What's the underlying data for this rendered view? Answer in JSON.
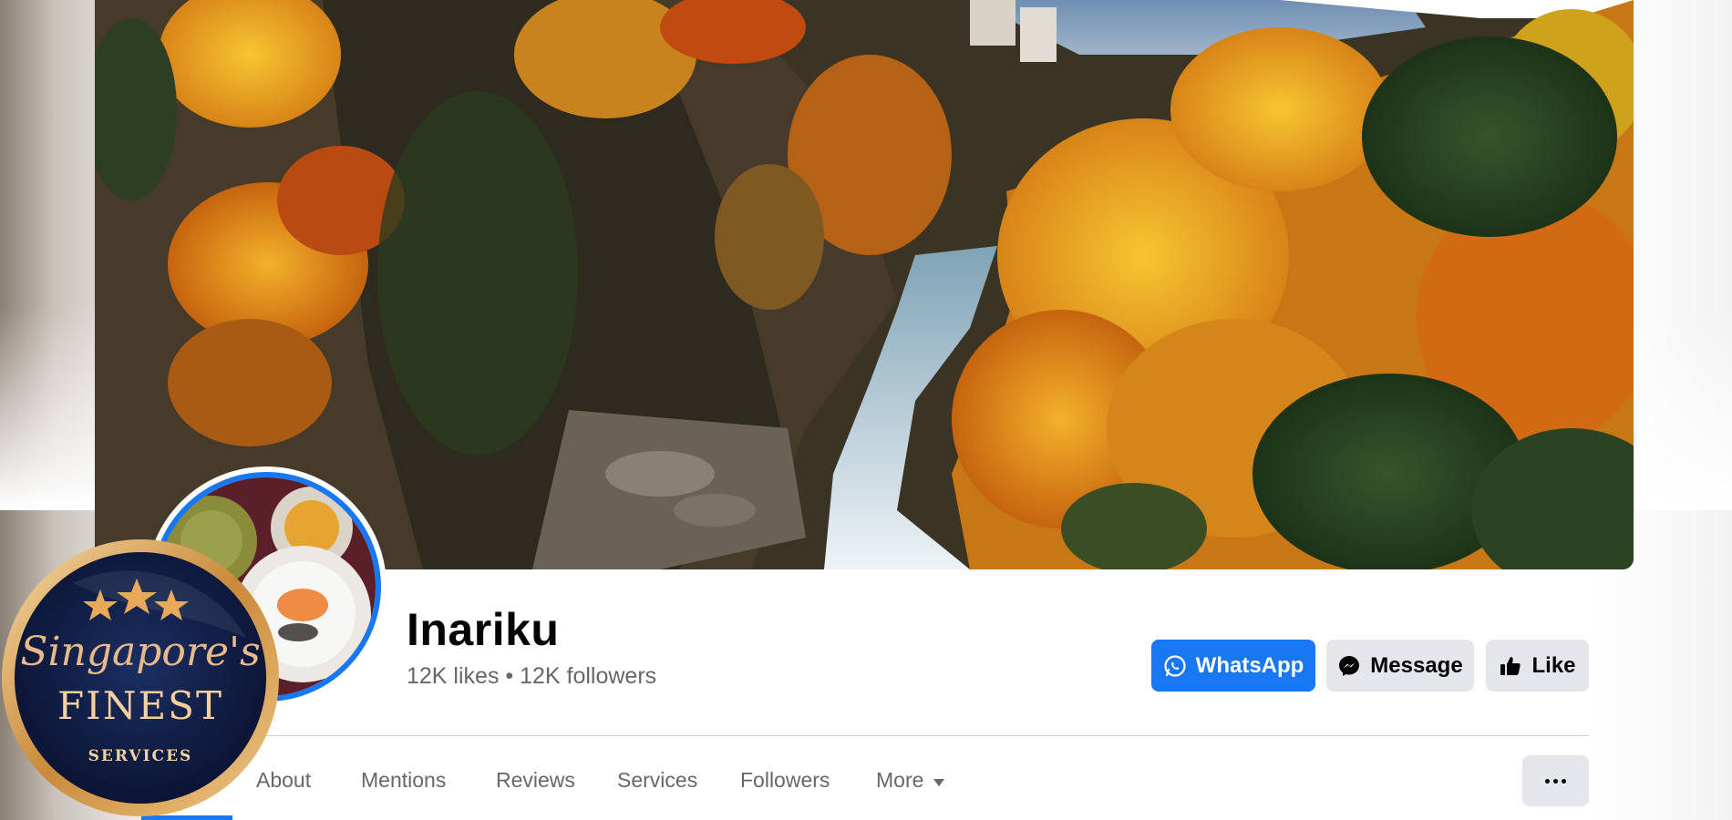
{
  "page": {
    "name": "Inariku",
    "stats": "12K likes • 12K followers"
  },
  "actions": {
    "whatsapp_label": "WhatsApp",
    "message_label": "Message",
    "like_label": "Like"
  },
  "tabs": [
    "About",
    "Mentions",
    "Reviews",
    "Services",
    "Followers",
    "More"
  ],
  "badge": {
    "line1": "Singapore's",
    "line2": "FINEST",
    "line3": "SERVICES"
  },
  "colors": {
    "accent": "#1877f2",
    "secondary_button": "#e4e6eb",
    "text_primary": "#050505",
    "text_secondary": "#65676b"
  },
  "icons": {
    "whatsapp": "whatsapp-icon",
    "messenger": "messenger-icon",
    "like": "thumbs-up-icon",
    "more_caret": "caret-down-icon",
    "overflow": "ellipsis-icon"
  }
}
